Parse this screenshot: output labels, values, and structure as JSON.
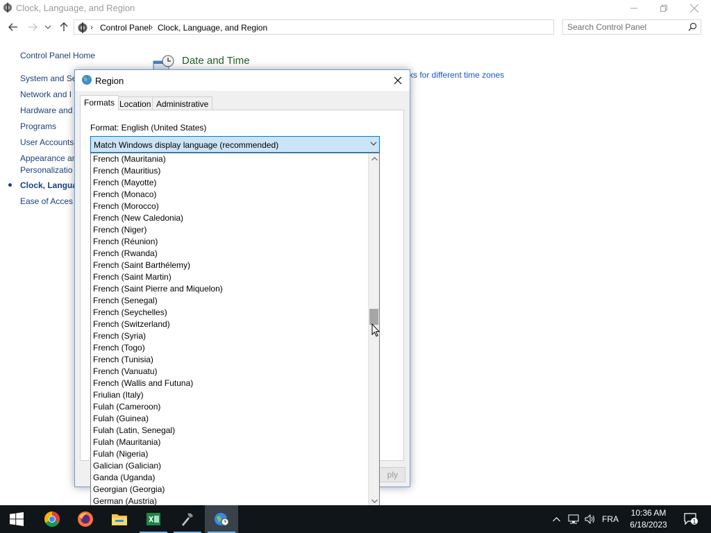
{
  "control_panel": {
    "title": "Clock, Language, and Region",
    "breadcrumbs": [
      "Control Panel",
      "Clock, Language, and Region"
    ],
    "search_placeholder": "Search Control Panel",
    "sidebar": [
      {
        "label": "Control Panel Home",
        "active": false
      },
      {
        "label": "System and Se",
        "active": false
      },
      {
        "label": "Network and I",
        "active": false
      },
      {
        "label": "Hardware and",
        "active": false
      },
      {
        "label": "Programs",
        "active": false
      },
      {
        "label": "User Accounts",
        "active": false
      },
      {
        "label": "Appearance an",
        "active": false
      },
      {
        "label": "Personalizatio",
        "active": false
      },
      {
        "label": "Clock, Langua",
        "active": true
      },
      {
        "label": "Ease of Acces",
        "active": false
      }
    ],
    "section_title": "Date and Time",
    "section_link": "ks for different time zones"
  },
  "region_dialog": {
    "title": "Region",
    "tabs": [
      {
        "label": "Formats",
        "active": true
      },
      {
        "label": "Location",
        "active": false
      },
      {
        "label": "Administrative",
        "active": false
      }
    ],
    "format_label": "Format: English (United States)",
    "selected_format": "Match Windows display language (recommended)",
    "apply_label": "ply",
    "dropdown_items": [
      "French (Mauritania)",
      "French (Mauritius)",
      "French (Mayotte)",
      "French (Monaco)",
      "French (Morocco)",
      "French (New Caledonia)",
      "French (Niger)",
      "French (Réunion)",
      "French (Rwanda)",
      "French (Saint Barthélemy)",
      "French (Saint Martin)",
      "French (Saint Pierre and Miquelon)",
      "French (Senegal)",
      "French (Seychelles)",
      "French (Switzerland)",
      "French (Syria)",
      "French (Togo)",
      "French (Tunisia)",
      "French (Vanuatu)",
      "French (Wallis and Futuna)",
      "Friulian (Italy)",
      "Fulah (Cameroon)",
      "Fulah (Guinea)",
      "Fulah (Latin, Senegal)",
      "Fulah (Mauritania)",
      "Fulah (Nigeria)",
      "Galician (Galician)",
      "Ganda (Uganda)",
      "Georgian (Georgia)",
      "German (Austria)"
    ]
  },
  "taskbar": {
    "apps": [
      "windows-start",
      "chrome",
      "firefox",
      "file-explorer",
      "spreadsheet-app",
      "tool-app",
      "region-settings"
    ],
    "input_language": "FRA",
    "time": "10:36 AM",
    "date": "6/18/2023",
    "notification_count": "1"
  }
}
